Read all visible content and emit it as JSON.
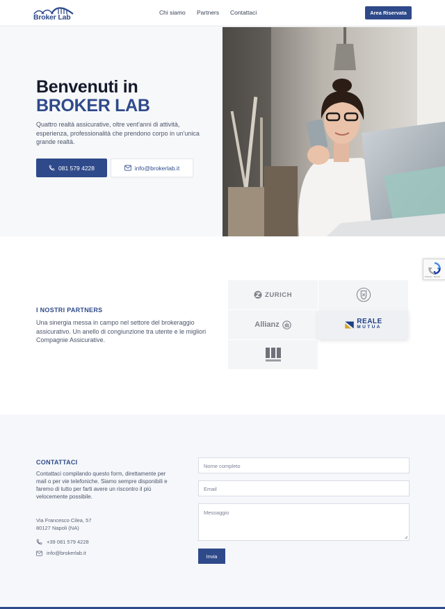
{
  "header": {
    "logo_text": "Broker Lab",
    "nav": [
      "Chi siamo",
      "Partners",
      "Contattaci"
    ],
    "cta_label": "Area Riservata"
  },
  "hero": {
    "title_line1": "Benvenuti in",
    "title_line2": "BROKER LAB",
    "description": "Quattro realtà assicurative, oltre vent'anni di attività, esperienza, professionalità che prendono corpo in un'unica grande realtà.",
    "phone_button": "081 579 4228",
    "email_button": "info@brokerlab.it"
  },
  "partners": {
    "title": "I NOSTRI PARTNERS",
    "description": "Una sinergia messa in campo nel settore del brokeraggio assicurativo. Un anello di congiunzione tra utente e le migliori Compagnie Assicurative.",
    "logos": {
      "zurich": "ZURICH",
      "allianz": "Allianz",
      "reale_line1": "REALE",
      "reale_line2": "MUTUA",
      "tua": "TUA"
    }
  },
  "recaptcha": {
    "links": "Privacy - Termini"
  },
  "contact": {
    "title": "CONTATTACI",
    "description": "Contattaci compilando questo form, direttamente per mail o per vie telefoniche. Siamo sempre disponibili e faremo di tutto per farti avere un riscontro il più velocemente possibile.",
    "address_line1": "Via Francesco Cilea, 57",
    "address_line2": "80127 Napoli (NA)",
    "phone": "+39 081 579 4228",
    "email": "info@brokerlab.it",
    "form": {
      "name_placeholder": "Nome completo",
      "email_placeholder": "Email",
      "message_placeholder": "Messaggio",
      "submit_label": "Invia"
    }
  },
  "colors": {
    "brand": "#2f4a8a",
    "title_dark": "#141a2b",
    "section_bg": "#f5f7fa"
  }
}
